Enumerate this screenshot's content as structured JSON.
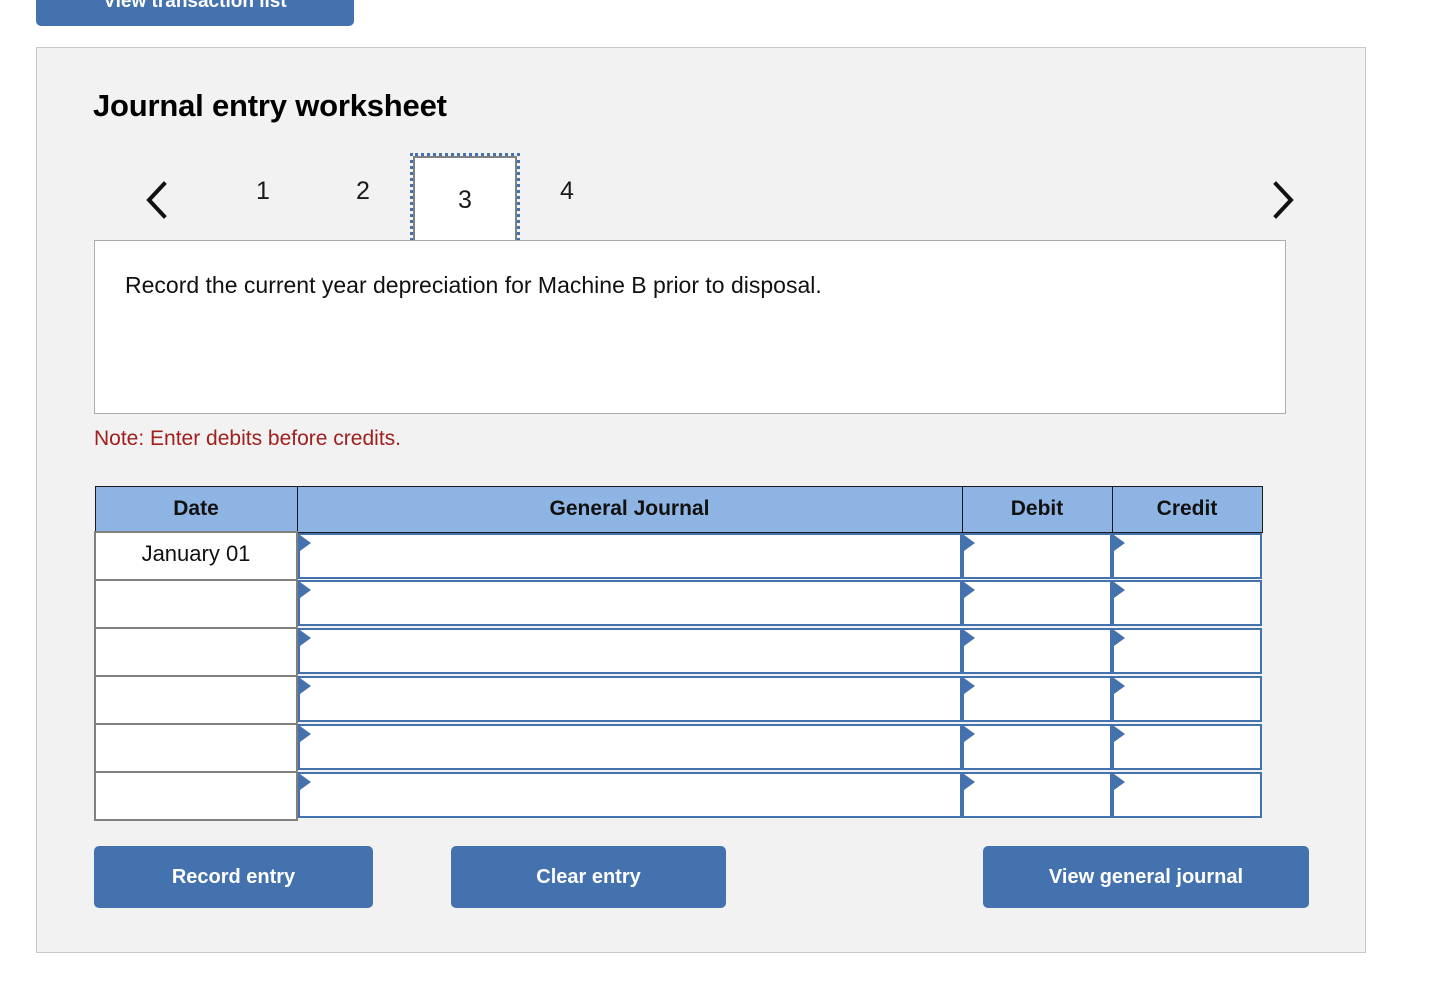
{
  "top": {
    "view_transaction_list_label": "View transaction list"
  },
  "card": {
    "title": "Journal entry worksheet",
    "pager": {
      "prev_icon": "chevron-left-icon",
      "next_icon": "chevron-right-icon",
      "pages": [
        "1",
        "2",
        "3",
        "4"
      ],
      "active_page": "3"
    },
    "instruction": "Record the current year depreciation for Machine B prior to disposal.",
    "note": "Note: Enter debits before credits.",
    "table": {
      "headers": [
        "Date",
        "General Journal",
        "Debit",
        "Credit"
      ],
      "rows": [
        {
          "date": "January 01",
          "general_journal": "",
          "debit": "",
          "credit": ""
        },
        {
          "date": "",
          "general_journal": "",
          "debit": "",
          "credit": ""
        },
        {
          "date": "",
          "general_journal": "",
          "debit": "",
          "credit": ""
        },
        {
          "date": "",
          "general_journal": "",
          "debit": "",
          "credit": ""
        },
        {
          "date": "",
          "general_journal": "",
          "debit": "",
          "credit": ""
        },
        {
          "date": "",
          "general_journal": "",
          "debit": "",
          "credit": ""
        }
      ]
    },
    "actions": {
      "record_entry_label": "Record entry",
      "clear_entry_label": "Clear entry",
      "view_general_journal_label": "View general journal"
    }
  },
  "colors": {
    "button_blue": "#4472AE",
    "header_blue": "#8DB4E2",
    "note_red": "#A02020",
    "card_background": "#F2F2F2",
    "field_border": "#4472AE"
  }
}
